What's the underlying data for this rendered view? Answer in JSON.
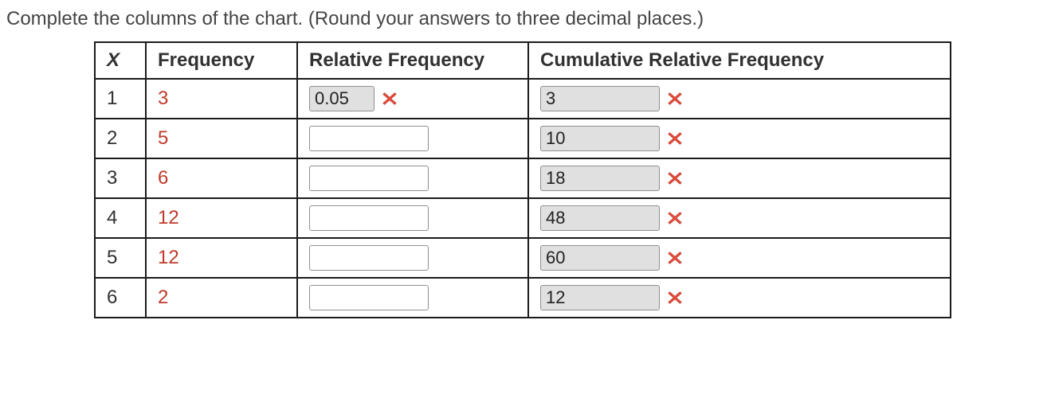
{
  "instruction": "Complete the columns of the chart. (Round your answers to three decimal places.)",
  "headers": {
    "x": "X",
    "frequency": "Frequency",
    "relative": "Relative Frequency",
    "cumulative": "Cumulative Relative Frequency"
  },
  "chart_data": {
    "type": "table",
    "title": "Frequency distribution",
    "columns": [
      "X",
      "Frequency",
      "Relative Frequency",
      "Cumulative Relative Frequency"
    ],
    "rows": [
      {
        "x": 1,
        "frequency": 3,
        "relative": "0.05",
        "cumulative": "3"
      },
      {
        "x": 2,
        "frequency": 5,
        "relative": "",
        "cumulative": "10"
      },
      {
        "x": 3,
        "frequency": 6,
        "relative": "",
        "cumulative": "18"
      },
      {
        "x": 4,
        "frequency": 12,
        "relative": "",
        "cumulative": "48"
      },
      {
        "x": 5,
        "frequency": 12,
        "relative": "",
        "cumulative": "60"
      },
      {
        "x": 6,
        "frequency": 2,
        "relative": "",
        "cumulative": "12"
      }
    ]
  },
  "rows": [
    {
      "x": "1",
      "frequency": "3",
      "relative": {
        "value": "0.05",
        "wrong": true,
        "short": true
      },
      "cumulative": {
        "value": "3",
        "wrong": true
      }
    },
    {
      "x": "2",
      "frequency": "5",
      "relative": {
        "value": "",
        "wrong": false
      },
      "cumulative": {
        "value": "10",
        "wrong": true
      }
    },
    {
      "x": "3",
      "frequency": "6",
      "relative": {
        "value": "",
        "wrong": false
      },
      "cumulative": {
        "value": "18",
        "wrong": true
      }
    },
    {
      "x": "4",
      "frequency": "12",
      "relative": {
        "value": "",
        "wrong": false
      },
      "cumulative": {
        "value": "48",
        "wrong": true
      }
    },
    {
      "x": "5",
      "frequency": "12",
      "relative": {
        "value": "",
        "wrong": false
      },
      "cumulative": {
        "value": "60",
        "wrong": true
      }
    },
    {
      "x": "6",
      "frequency": "2",
      "relative": {
        "value": "",
        "wrong": false
      },
      "cumulative": {
        "value": "12",
        "wrong": true
      }
    }
  ],
  "colors": {
    "frequency_text": "#c0392b",
    "wrong_icon": "#e74c3c"
  }
}
